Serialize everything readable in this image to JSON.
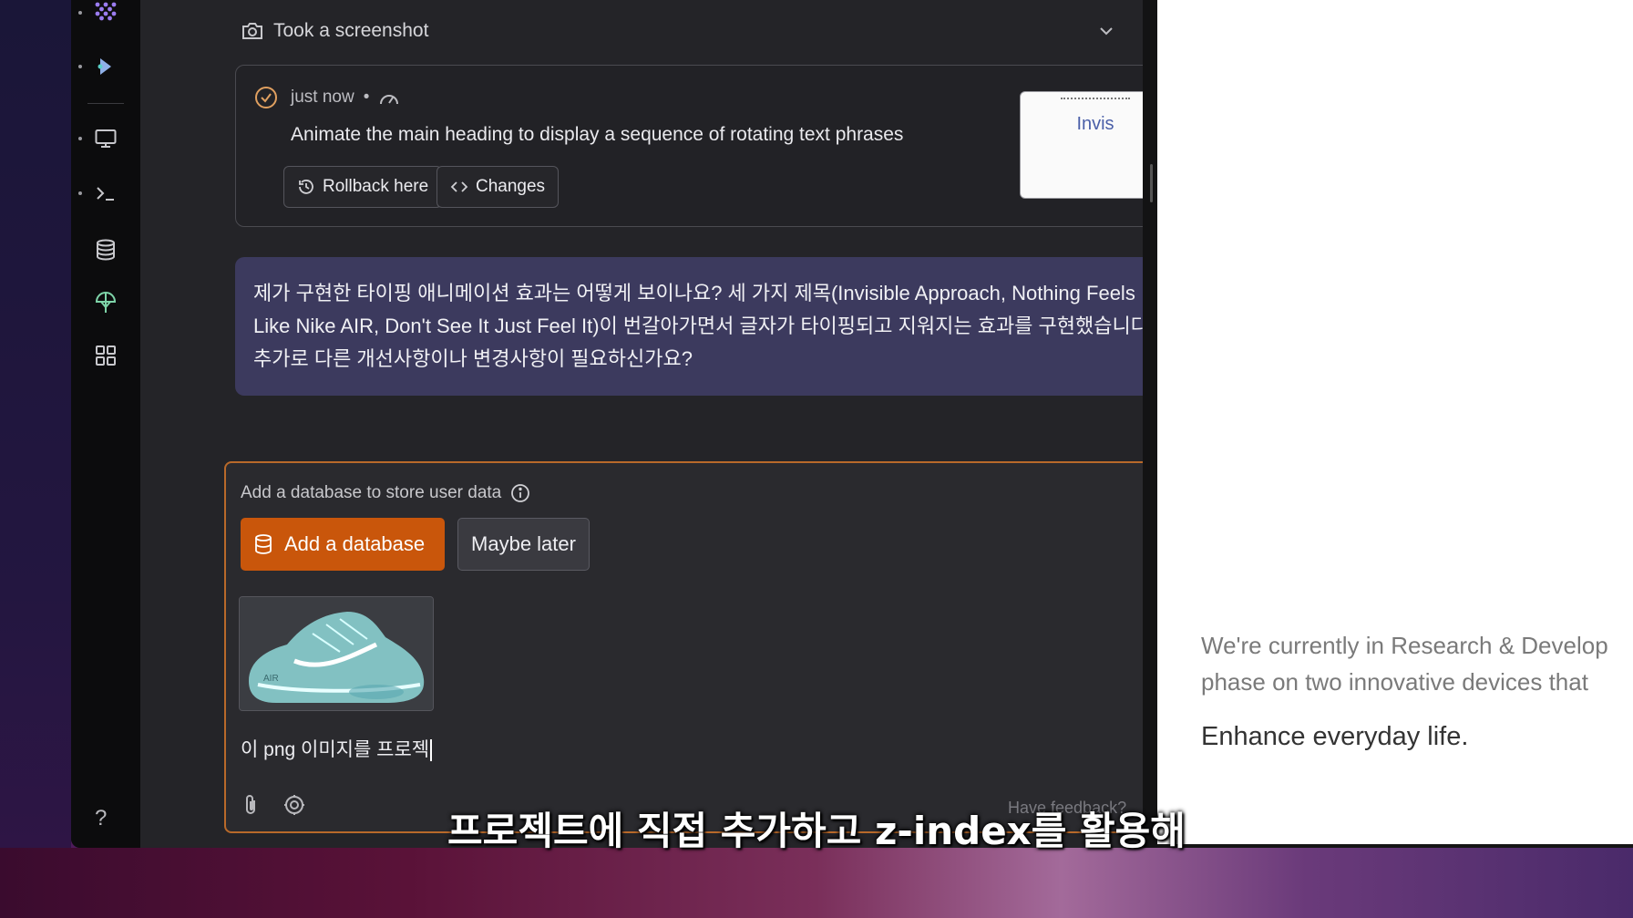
{
  "screenshot_step": {
    "title": "Took a screenshot"
  },
  "checkpoint": {
    "time": "just now",
    "separator": "•",
    "description": "Animate the main heading to display a sequence of rotating text phrases",
    "rollback_label": "Rollback here",
    "changes_label": "Changes",
    "thumbnail_text": "Invis"
  },
  "assistant_message": {
    "lines": [
      "제가 구현한 타이핑 애니메이션 효과는 어떻게 보이나요? 세 가지 제목(Invisible Approach, Nothing Feels",
      "Like Nike AIR, Don't See It Just Feel It)이 번갈아가면서 글자가 타이핑되고 지워지는 효과를 구현했습니다.",
      "추가로 다른 개선사항이나 변경사항이 필요하신가요?"
    ]
  },
  "composer": {
    "db_prompt": "Add a database to store user data",
    "add_db_label": "Add a database",
    "maybe_later_label": "Maybe later",
    "attachment_badge": "AIR",
    "input_text": "이 png 이미지를 프로젝",
    "feedback_label": "Have feedback?"
  },
  "preview": {
    "paragraph_lines": [
      "We're currently in Research & Develop",
      "phase on two innovative devices that"
    ],
    "heading": "Enhance everyday life."
  },
  "help_label": "?",
  "subtitle": "프로젝트에 직접 추가하고 z-index를 활용해",
  "colors": {
    "accent_orange": "#c9560b",
    "assistant_bubble": "#3c3a5e",
    "panel_bg": "#242428"
  }
}
